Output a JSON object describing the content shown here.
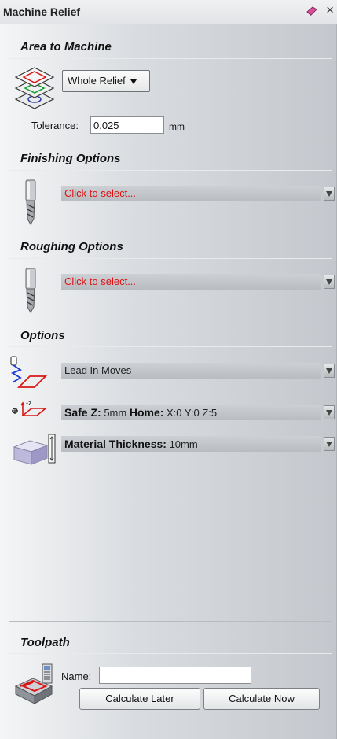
{
  "window": {
    "title": "Machine Relief",
    "close_glyph": "×"
  },
  "area": {
    "heading": "Area to Machine",
    "mode_value": "Whole Relief",
    "tolerance_label": "Tolerance:",
    "tolerance_value": "0.025",
    "tolerance_unit": "mm"
  },
  "finishing": {
    "heading": "Finishing Options",
    "tool_text": "Click to select..."
  },
  "roughing": {
    "heading": "Roughing Options",
    "tool_text": "Click to select..."
  },
  "options": {
    "heading": "Options",
    "lead_in": "Lead In Moves",
    "safe_z_label": "Safe Z:",
    "safe_z_value": "5mm",
    "home_label": "Home:",
    "home_value": "X:0 Y:0 Z:5",
    "thickness_label": "Material Thickness:",
    "thickness_value": "10mm"
  },
  "toolpath": {
    "heading": "Toolpath",
    "name_label": "Name:",
    "name_value": "",
    "calc_later": "Calculate Later",
    "calc_now": "Calculate Now"
  },
  "icons": {
    "pin": "eraser-pin-icon",
    "area": "layers-icon",
    "tool": "end-mill-icon",
    "lead_in": "lead-in-icon",
    "safe_z": "safe-z-icon",
    "thickness": "material-block-icon",
    "toolpath": "toolpath-icon"
  },
  "colors": {
    "placeholder_red": "#e01010",
    "strip": "#c3c7cc"
  }
}
